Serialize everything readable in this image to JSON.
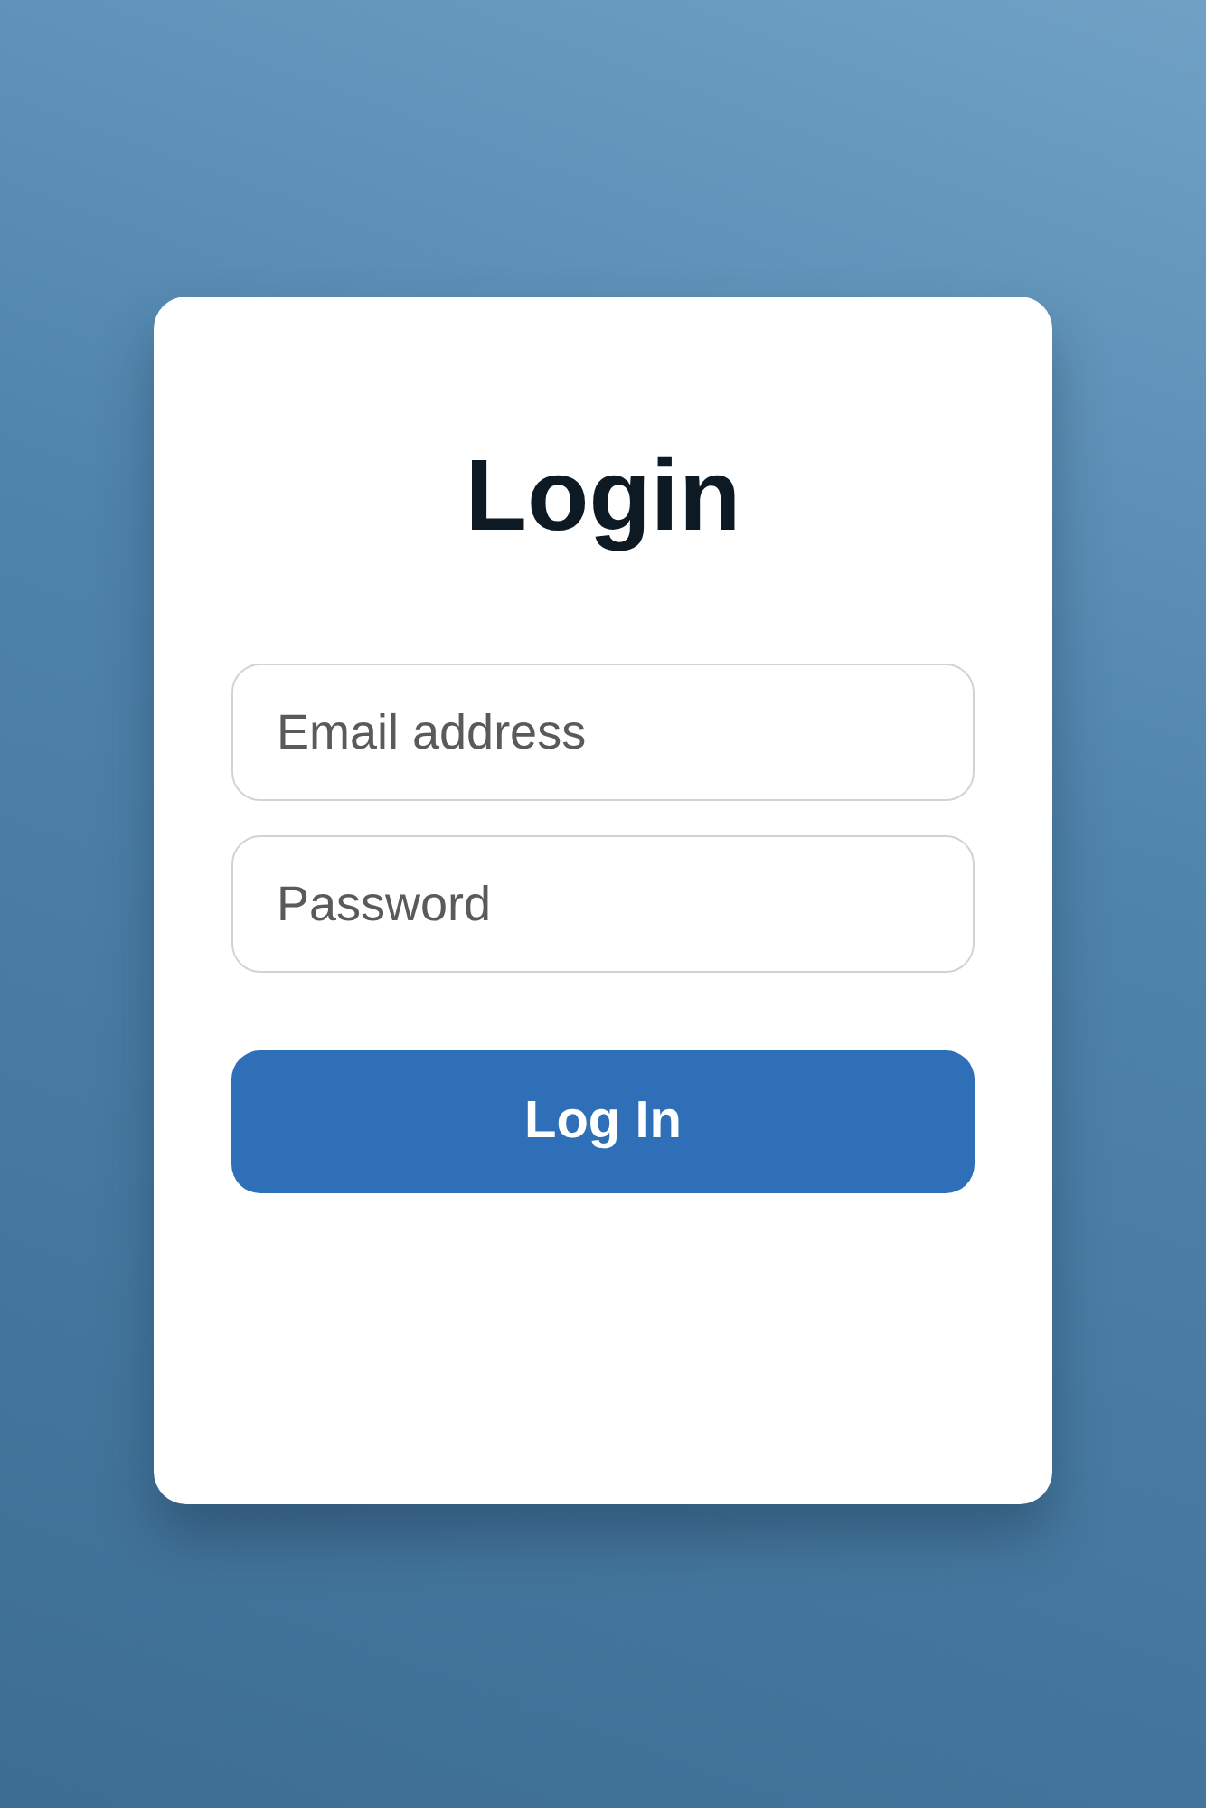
{
  "card": {
    "title": "Login",
    "fields": [
      {
        "placeholder": "Email address"
      },
      {
        "placeholder": "Password"
      }
    ],
    "button": {
      "label": "Log In"
    }
  }
}
